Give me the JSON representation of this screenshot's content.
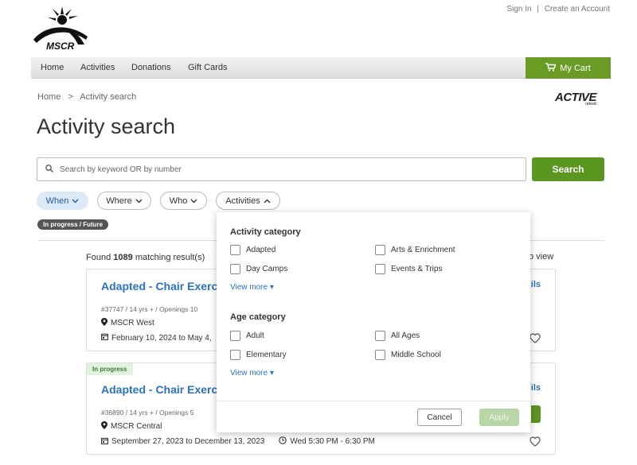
{
  "header": {
    "logo_text": "MSCR",
    "top_links": [
      "Sign In",
      "Create an Account"
    ],
    "separator": "|"
  },
  "nav": {
    "items": [
      "Home",
      "Activities",
      "Donations",
      "Gift Cards"
    ],
    "cart_label": "My Cart"
  },
  "breadcrumb": {
    "home": "Home",
    "sep": ">",
    "current": "Activity search"
  },
  "brand": {
    "active": "ACTIVE",
    "network": "network"
  },
  "page_title": "Activity search",
  "search": {
    "placeholder": "Search by keyword OR by number",
    "button": "Search"
  },
  "filters": [
    "When",
    "Where",
    "Who",
    "Activities"
  ],
  "status_pill": "In progress / Future",
  "results": {
    "prefix": "Found",
    "count": "1089",
    "suffix": "matching result(s)",
    "view_toggle_partial": "o view"
  },
  "cards": [
    {
      "title": "Adapted - Chair Exerc",
      "meta": "#37747 / 14 yrs + / Openings 10",
      "location": "MSCR West",
      "dates": "February 10, 2024 to May 4,",
      "details_partial": "ils"
    },
    {
      "badge": "In progress",
      "title": "Adapted - Chair Exerc",
      "meta": "#36890 / 14 yrs + / Openings 5",
      "location": "MSCR Central",
      "dates": "September 27, 2023 to December 13, 2023",
      "time": "Wed 5:30 PM - 6:30 PM",
      "details_partial": "ils"
    }
  ],
  "popover": {
    "activity_category": {
      "title": "Activity category",
      "options": [
        "Adapted",
        "Arts & Enrichment",
        "Day Camps",
        "Events & Trips"
      ],
      "view_more": "View more ▾"
    },
    "age_category": {
      "title": "Age category",
      "options": [
        "Adult",
        "All Ages",
        "Elementary",
        "Middle School"
      ],
      "view_more": "View more ▾"
    },
    "cancel": "Cancel",
    "apply": "Apply"
  },
  "colors": {
    "brand_green": "#5a9620",
    "link_blue": "#2a72c2",
    "when_bg": "#dbe9f8"
  }
}
